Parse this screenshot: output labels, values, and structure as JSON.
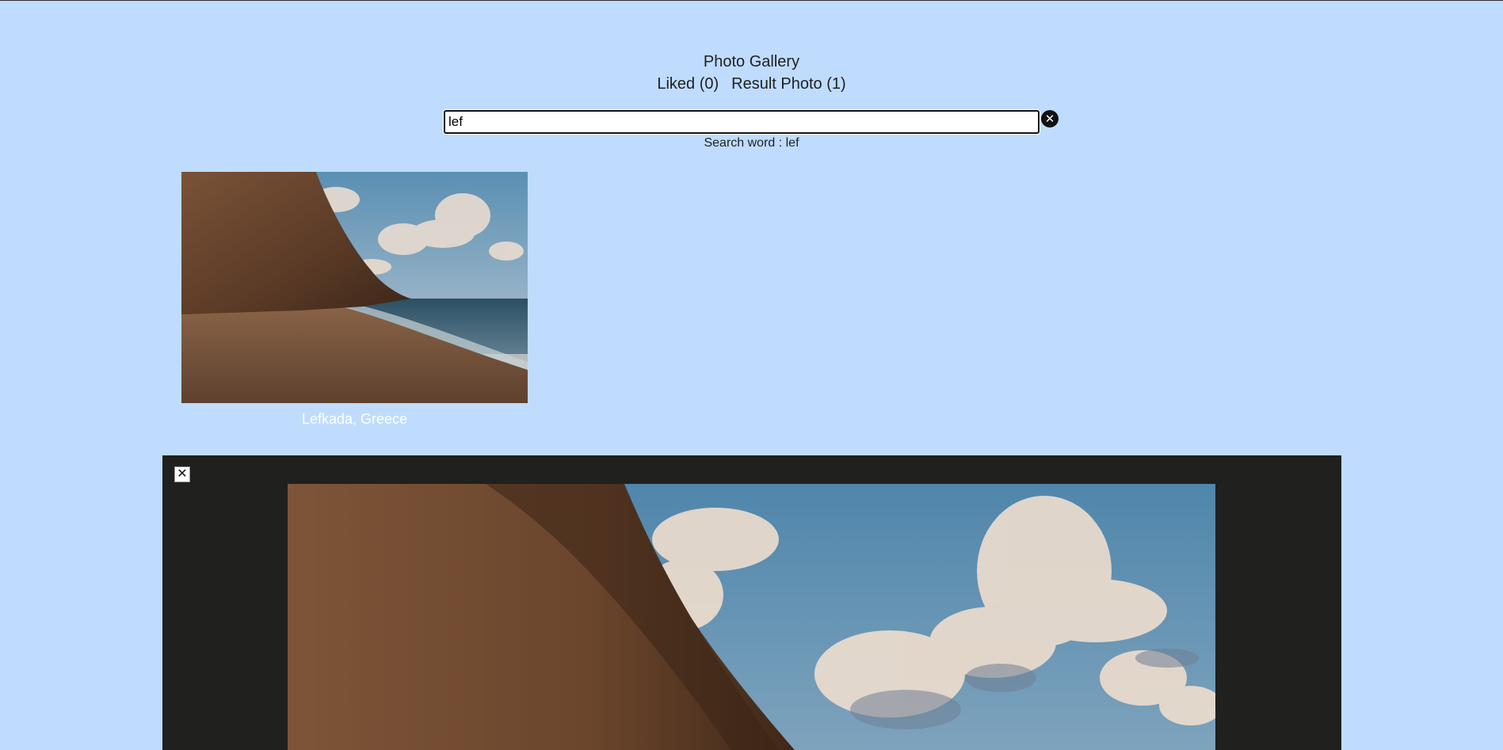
{
  "header": {
    "title": "Photo Gallery",
    "liked_label": "Liked (0)",
    "result_label": "Result Photo (1)"
  },
  "search": {
    "value": "lef",
    "clear_icon": "close-circle-icon",
    "search_word_text": "Search word : lef"
  },
  "results": [
    {
      "caption": "Lefkada, Greece"
    }
  ],
  "modal": {
    "close_icon": "close-icon"
  },
  "colors": {
    "background": "#bfdcfe",
    "modal_background": "#20201e",
    "caption": "#ffffff"
  }
}
